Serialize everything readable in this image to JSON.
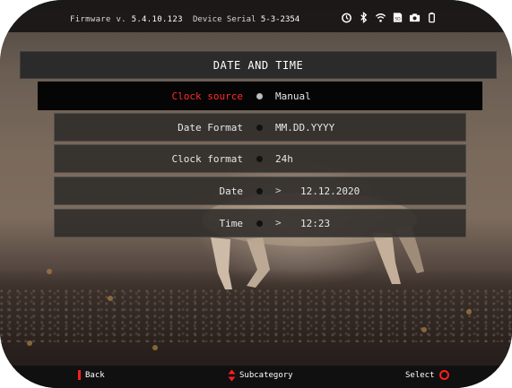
{
  "status_bar": {
    "firmware_label": "Firmware v.",
    "firmware_version": "5.4.10.123",
    "serial_label": "Device Serial",
    "serial_number": "5-3-2354",
    "icons": [
      "timer-icon",
      "bluetooth-icon",
      "wifi-icon",
      "sd-card-icon",
      "camera-icon",
      "battery-icon"
    ]
  },
  "header": {
    "title": "DATE AND TIME"
  },
  "menu": {
    "items": [
      {
        "label": "Clock source",
        "value": "Manual",
        "has_arrow": false,
        "selected": true
      },
      {
        "label": "Date Format",
        "value": "MM.DD.YYYY",
        "has_arrow": false,
        "selected": false
      },
      {
        "label": "Clock format",
        "value": "24h",
        "has_arrow": false,
        "selected": false
      },
      {
        "label": "Date",
        "value": "12.12.2020",
        "has_arrow": true,
        "selected": false
      },
      {
        "label": "Time",
        "value": "12:23",
        "has_arrow": true,
        "selected": false
      }
    ]
  },
  "bottom_bar": {
    "back_label": "Back",
    "subcategory_label": "Subcategory",
    "select_label": "Select"
  },
  "colors": {
    "accent_red": "#ff2b2b",
    "selected_row_bg": "#050505",
    "row_bg": "#2c2a28"
  }
}
